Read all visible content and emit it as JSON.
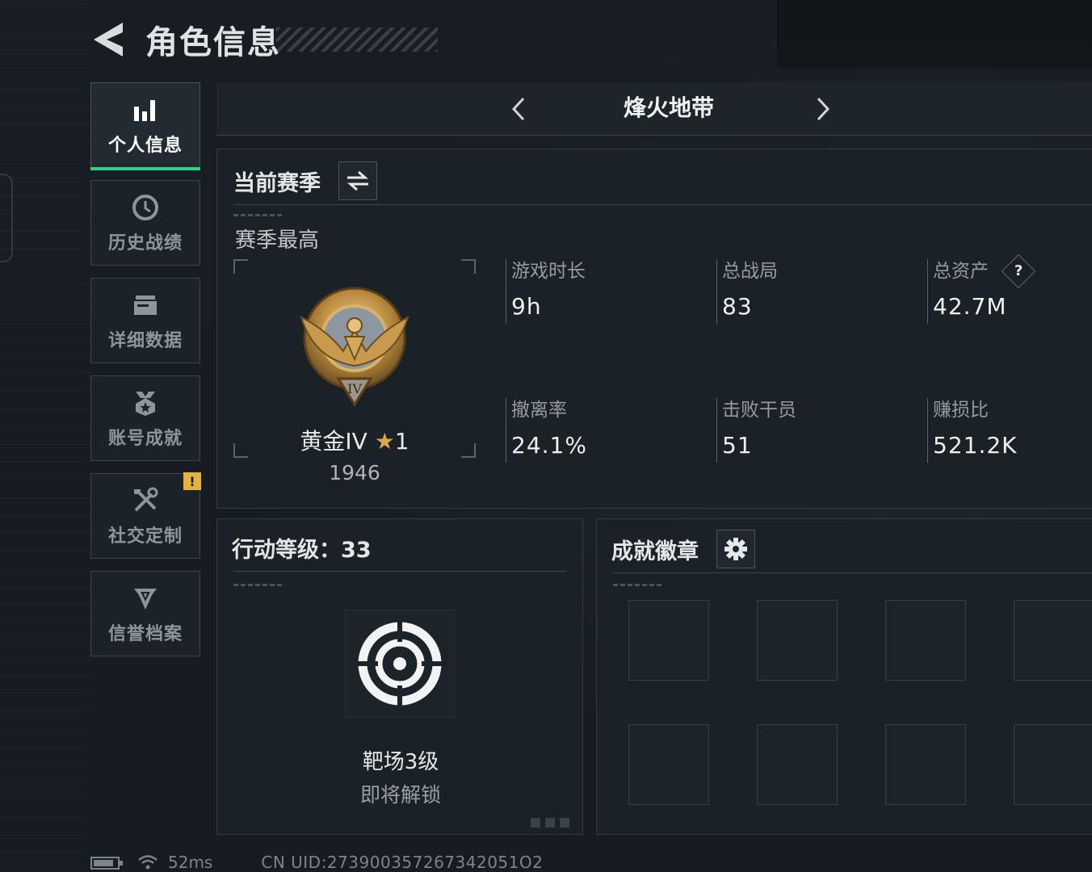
{
  "header": {
    "title": "角色信息"
  },
  "sidebar": {
    "items": [
      {
        "label": "个人信息",
        "icon": "bar-chart-icon",
        "active": true
      },
      {
        "label": "历史战绩",
        "icon": "clock-icon"
      },
      {
        "label": "详细数据",
        "icon": "folder-icon"
      },
      {
        "label": "账号成就",
        "icon": "medal-icon"
      },
      {
        "label": "社交定制",
        "icon": "tools-icon",
        "alert": "!"
      },
      {
        "label": "信誉档案",
        "icon": "shield-emblem-icon"
      }
    ]
  },
  "mode": {
    "title": "烽火地带"
  },
  "season": {
    "title": "当前赛季",
    "best_label": "赛季最高",
    "rank": {
      "name": "黄金IV",
      "stars": "1",
      "score": "1946",
      "emblem_numeral": "IV"
    },
    "stats": [
      {
        "label": "游戏时长",
        "value": "9h"
      },
      {
        "label": "总战局",
        "value": "83"
      },
      {
        "label": "总资产",
        "value": "42.7M",
        "help": "?"
      },
      {
        "label": "撤离率",
        "value": "24.1%"
      },
      {
        "label": "击败干员",
        "value": "51"
      },
      {
        "label": "赚损比",
        "value": "521.2K"
      }
    ]
  },
  "level": {
    "title": "行动等级：33",
    "reward_name": "靶场3级",
    "reward_status": "即将解锁"
  },
  "badges": {
    "title": "成就徽章",
    "slots": 8
  },
  "status": {
    "ping": "52ms",
    "uid": "CN UID:273900357267342051O2"
  },
  "colors": {
    "accent_green": "#2fd48c",
    "alert_yellow": "#e5b339",
    "gold": "#d7a84b"
  }
}
